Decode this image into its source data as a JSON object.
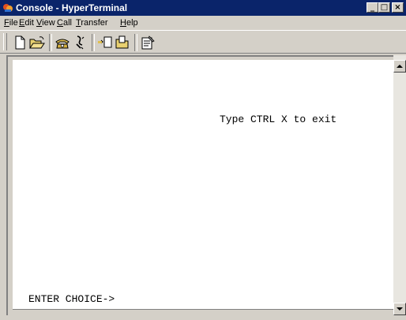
{
  "window": {
    "title": "Console - HyperTerminal",
    "controls": {
      "minimize": "_",
      "maximize": "□",
      "close": "×"
    }
  },
  "menu": [
    {
      "label": "File",
      "key": "F",
      "rest": "ile"
    },
    {
      "label": "Edit",
      "key": "E",
      "rest": "dit"
    },
    {
      "label": "View",
      "key": "V",
      "rest": "iew"
    },
    {
      "label": "Call",
      "key": "C",
      "rest": "all"
    },
    {
      "label": "Transfer",
      "key": "T",
      "rest": "ransfer"
    },
    {
      "label": "Help",
      "key": "H",
      "rest": "elp"
    }
  ],
  "toolbar": {
    "icons": [
      "new-connection-icon",
      "open-icon",
      "call-icon",
      "disconnect-icon",
      "send-icon",
      "receive-icon",
      "properties-icon"
    ]
  },
  "terminal": {
    "line1": "Type CTRL X to exit",
    "line2": "ENTER CHOICE->"
  },
  "colors": {
    "titlebar": "#0a246a",
    "chrome": "#d4d0c8",
    "terminal_bg": "#ffffff",
    "terminal_text": "#000000"
  }
}
